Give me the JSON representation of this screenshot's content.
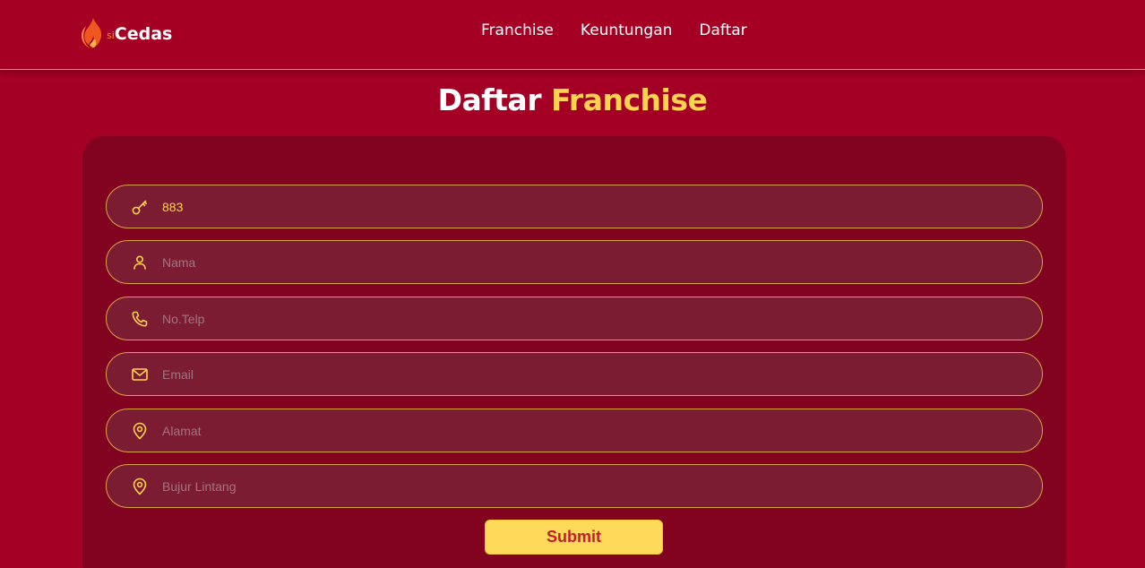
{
  "colors": {
    "background": "#a40025",
    "panel": "#820320",
    "field": "#7c1c33",
    "accent_yellow": "#ffd34e",
    "field_border": "#d9a441",
    "submit_text": "#c41d2b"
  },
  "header": {
    "logo_prefix": "si",
    "logo_name": "Cedas",
    "logo_icon": "flame-icon",
    "nav": [
      {
        "label": "Franchise"
      },
      {
        "label": "Keuntungan"
      },
      {
        "label": "Daftar"
      }
    ]
  },
  "page": {
    "title_part1": "Daftar",
    "title_part2": "Franchise"
  },
  "form": {
    "fields": [
      {
        "icon": "key-icon",
        "value": "883",
        "placeholder": ""
      },
      {
        "icon": "user-icon",
        "value": "",
        "placeholder": "Nama"
      },
      {
        "icon": "phone-icon",
        "value": "",
        "placeholder": "No.Telp"
      },
      {
        "icon": "mail-icon",
        "value": "",
        "placeholder": "Email"
      },
      {
        "icon": "location-icon",
        "value": "",
        "placeholder": "Alamat"
      },
      {
        "icon": "location-icon",
        "value": "",
        "placeholder": "Bujur Lintang"
      }
    ],
    "submit_label": "Submit"
  }
}
